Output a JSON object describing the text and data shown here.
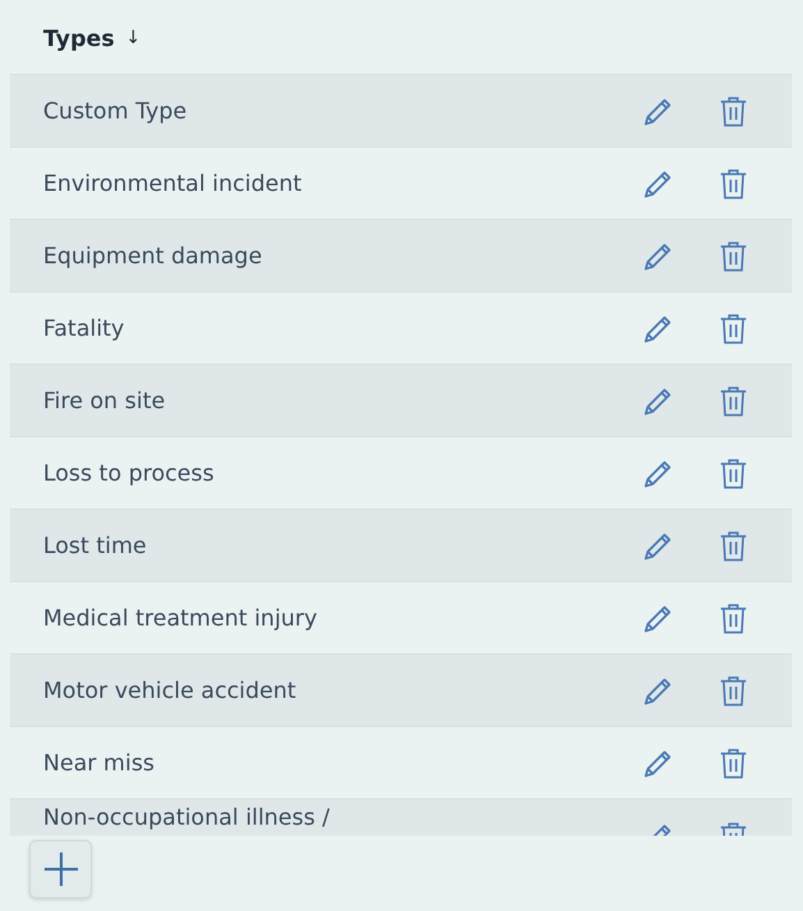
{
  "header": {
    "label": "Types",
    "sort_icon": "↓"
  },
  "rows": [
    {
      "name": "Custom Type"
    },
    {
      "name": "Environmental incident"
    },
    {
      "name": "Equipment damage"
    },
    {
      "name": "Fatality"
    },
    {
      "name": "Fire on site"
    },
    {
      "name": "Loss to process"
    },
    {
      "name": "Lost time"
    },
    {
      "name": "Medical treatment injury"
    },
    {
      "name": "Motor vehicle accident"
    },
    {
      "name": "Near miss"
    },
    {
      "name": "Non-occupational illness /"
    }
  ]
}
